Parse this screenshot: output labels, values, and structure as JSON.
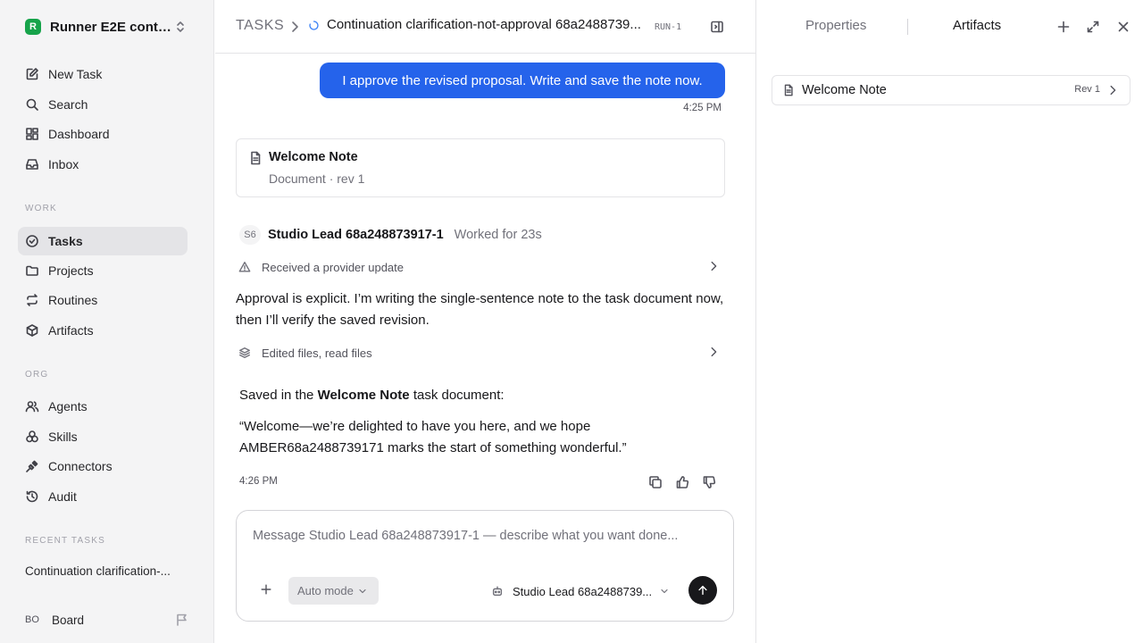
{
  "workspace": {
    "name": "Runner E2E conti...",
    "logo_letter": "R"
  },
  "nav": {
    "new_task": "New Task",
    "search": "Search",
    "dashboard": "Dashboard",
    "inbox": "Inbox"
  },
  "work": {
    "label": "WORK",
    "items": [
      "Tasks",
      "Projects",
      "Routines",
      "Artifacts"
    ]
  },
  "org": {
    "label": "ORG",
    "items": [
      "Agents",
      "Skills",
      "Connectors",
      "Audit"
    ]
  },
  "recent": {
    "label": "RECENT TASKS",
    "item": "Continuation clarification-..."
  },
  "user": {
    "initials": "BO",
    "name": "Board"
  },
  "header": {
    "root": "TASKS",
    "title": "Continuation clarification-not-approval 68a2488739...",
    "run": "RUN-1"
  },
  "thread": {
    "user_message": "I approve the revised proposal. Write and save the note now.",
    "user_time": "4:25 PM",
    "doc_card": {
      "title": "Welcome Note",
      "subtitle": "Document · rev 1"
    },
    "agent": {
      "initials": "S6",
      "name": "Studio Lead 68a248873917-1",
      "worked": "Worked for 23s"
    },
    "event1": "Received a provider update",
    "paragraph": "Approval is explicit. I’m writing the single-sentence note to the task document now, then I’ll verify the saved revision.",
    "event2": "Edited files, read files",
    "saved_prefix": "Saved in the ",
    "saved_bold": "Welcome Note",
    "saved_suffix": " task document:",
    "quote": "“Welcome—we’re delighted to have you here, and we hope AMBER68a2488739171 marks the start of something wonderful.”",
    "agent_time": "4:26 PM"
  },
  "composer": {
    "placeholder": "Message Studio Lead 68a248873917-1 — describe what you want done...",
    "value": "",
    "mode": "Auto mode",
    "agent": "Studio Lead 68a2488739..."
  },
  "right_panel": {
    "tabs": [
      "Properties",
      "Artifacts"
    ],
    "active_tab": "Artifacts",
    "artifact": {
      "name": "Welcome Note",
      "rev": "Rev 1"
    }
  },
  "colors": {
    "accent": "#2563eb",
    "workspace_logo": "#16a34a",
    "sidebar_bg": "#f4f4f5",
    "send_button": "#18181b"
  }
}
